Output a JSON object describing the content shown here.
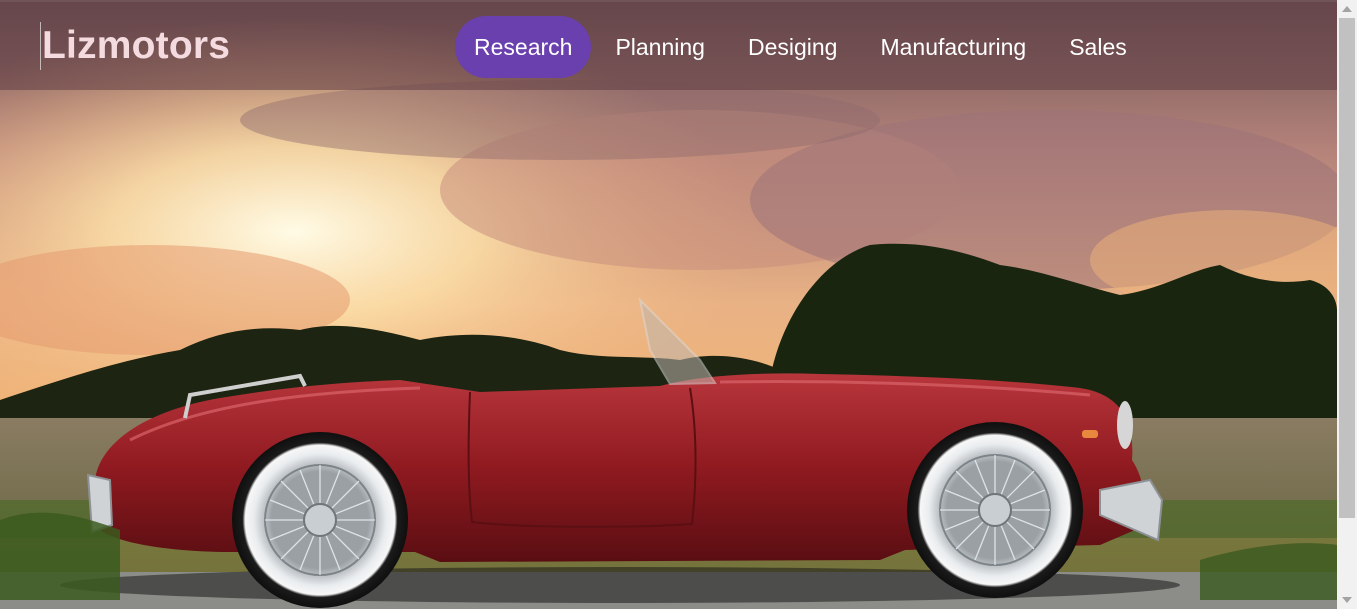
{
  "brand": {
    "name": "Lizmotors"
  },
  "nav": {
    "items": [
      {
        "label": "Research",
        "active": true
      },
      {
        "label": "Planning",
        "active": false
      },
      {
        "label": "Desiging",
        "active": false
      },
      {
        "label": "Manufacturing",
        "active": false
      },
      {
        "label": "Sales",
        "active": false
      }
    ]
  },
  "hero": {
    "image": "red-vintage-roadster-at-sunset"
  },
  "colors": {
    "accent": "#6a3fae",
    "navbar": "#5f3c42",
    "car": "#9b1c22"
  }
}
